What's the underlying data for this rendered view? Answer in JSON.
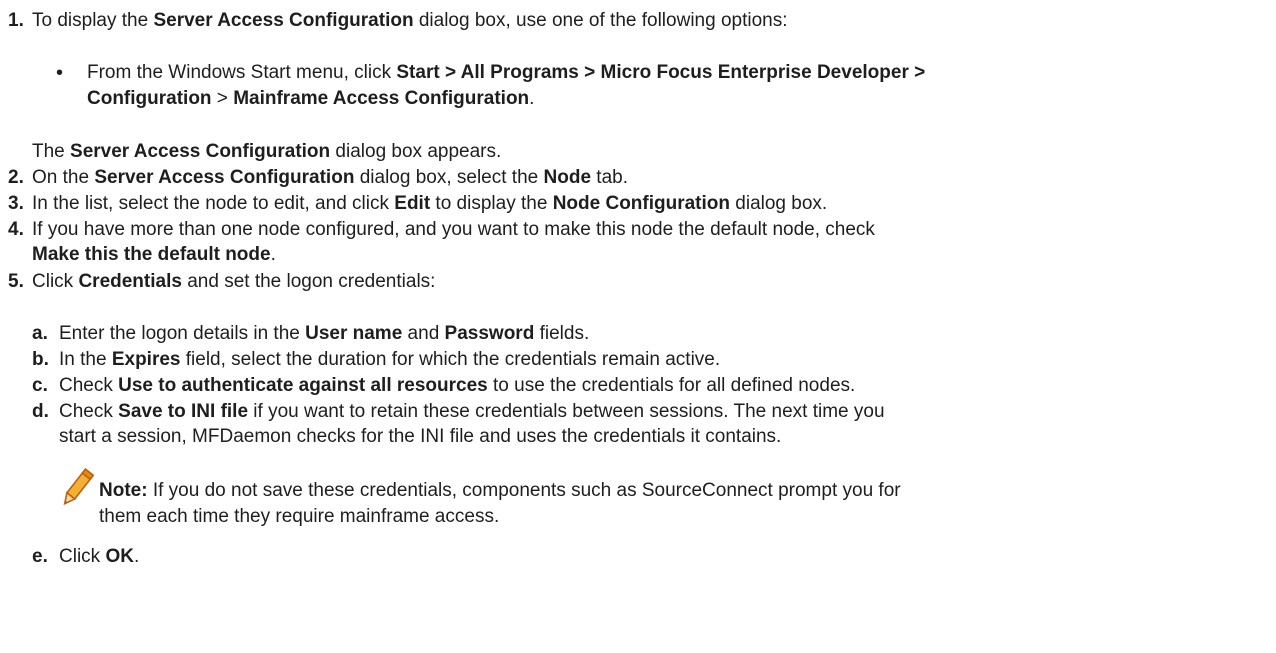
{
  "steps": [
    {
      "number": "1.",
      "line1": {
        "t1": "To display the ",
        "b1": "Server Access Configuration",
        "t2": " dialog box, use one of the following options:"
      },
      "bullet": {
        "symbol": "•",
        "line1": {
          "t1": "From the Windows Start menu, click ",
          "b1": "Start > All Programs > Micro Focus Enterprise Developer >"
        },
        "line2": {
          "b1": "Configuration",
          "t1": " > ",
          "b2": "Mainframe Access Configuration",
          "t2": "."
        }
      },
      "after": {
        "t1": "The ",
        "b1": "Server Access Configuration",
        "t2": " dialog box appears."
      }
    },
    {
      "number": "2.",
      "t1": "On the ",
      "b1": "Server Access Configuration",
      "t2": " dialog box, select the ",
      "b2": "Node",
      "t3": " tab."
    },
    {
      "number": "3.",
      "t1": "In the list, select the node to edit, and click ",
      "b1": "Edit",
      "t2": " to display the ",
      "b2": "Node Configuration",
      "t3": " dialog box."
    },
    {
      "number": "4.",
      "line1": "If you have more than one node configured, and you want to make this node the default node, check",
      "line2": {
        "b1": "Make this the default node",
        "t1": "."
      }
    },
    {
      "number": "5.",
      "t1": "Click ",
      "b1": "Credentials",
      "t2": " and set the logon credentials:",
      "substeps": [
        {
          "letter": "a.",
          "t1": "Enter the logon details in the ",
          "b1": "User name",
          "t2": " and ",
          "b2": "Password",
          "t3": " fields."
        },
        {
          "letter": "b.",
          "t1": "In the ",
          "b1": "Expires",
          "t2": " field, select the duration for which the credentials remain active."
        },
        {
          "letter": "c.",
          "t1": "Check ",
          "b1": "Use to authenticate against all resources",
          "t2": " to use the credentials for all defined nodes."
        },
        {
          "letter": "d.",
          "t1": "Check ",
          "b1": "Save to INI file",
          "t2": " if you want to retain these credentials between sessions. The next time you",
          "line2": "start a session, MFDaemon checks for the INI file and uses the credentials it contains.",
          "note": {
            "icon": "pencil-icon",
            "label": "Note:",
            "t1": " If you do not save these credentials, components such as SourceConnect prompt you for",
            "line2": "them each time they require mainframe access."
          }
        },
        {
          "letter": "e.",
          "t1": "Click ",
          "b1": "OK",
          "t2": "."
        }
      ]
    }
  ],
  "colors": {
    "text": "#1e1e1e",
    "pencil_body": "#f0a020",
    "pencil_outline": "#c06010"
  }
}
